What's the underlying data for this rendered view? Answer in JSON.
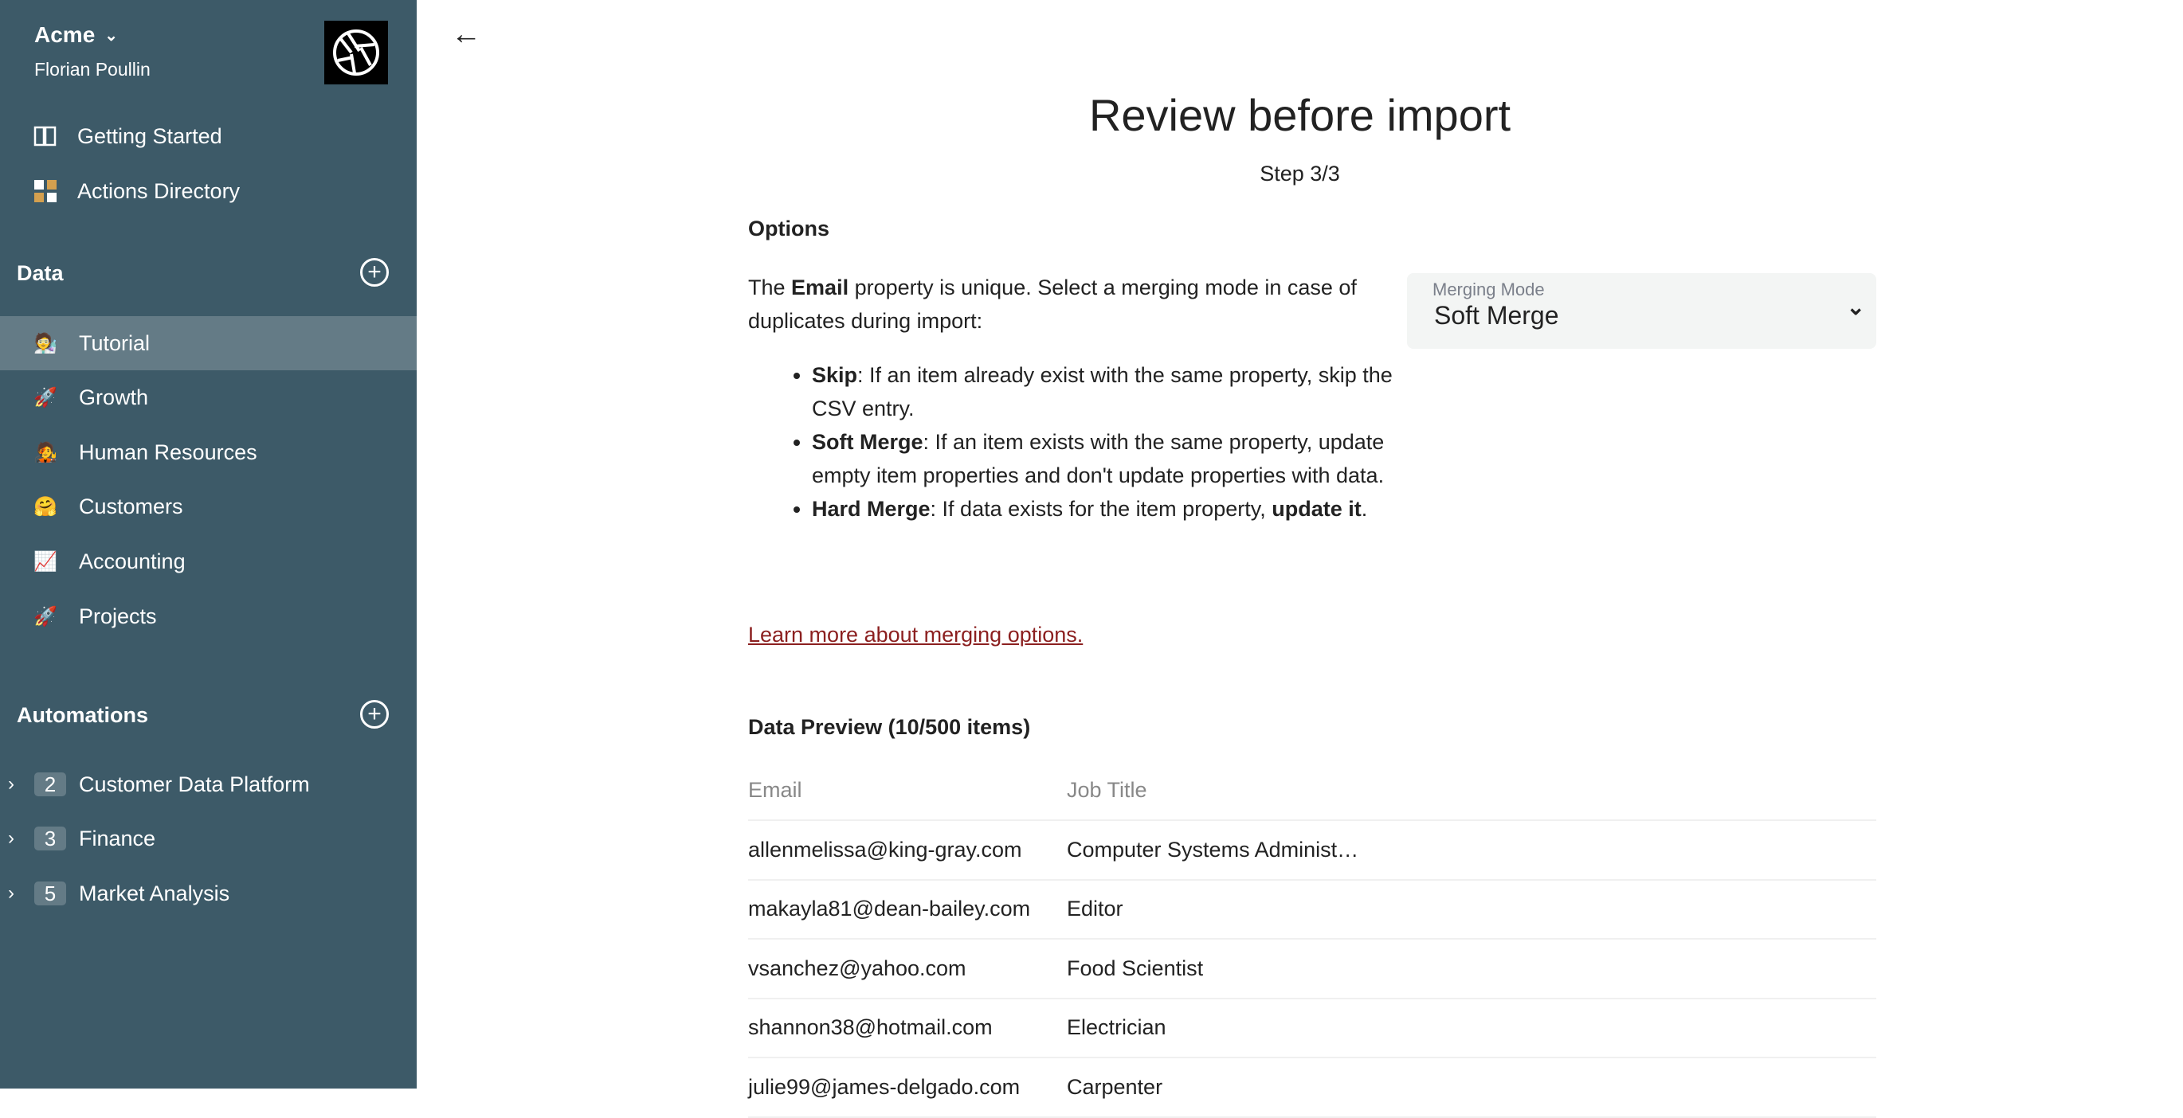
{
  "sidebar": {
    "workspace": "Acme",
    "user": "Florian Poullin",
    "top_items": [
      {
        "label": "Getting Started",
        "icon": "book-icon"
      },
      {
        "label": "Actions Directory",
        "icon": "grid-icon"
      }
    ],
    "data_section": {
      "title": "Data",
      "items": [
        {
          "label": "Tutorial",
          "emoji": "🧑‍🔬",
          "selected": true
        },
        {
          "label": "Growth",
          "emoji": "🚀"
        },
        {
          "label": "Human Resources",
          "emoji": "🧑‍🎤"
        },
        {
          "label": "Customers",
          "emoji": "🤗"
        },
        {
          "label": "Accounting",
          "emoji": "📈"
        },
        {
          "label": "Projects",
          "emoji": "🚀"
        }
      ]
    },
    "automations_section": {
      "title": "Automations",
      "items": [
        {
          "label": "Customer Data Platform",
          "count": "2"
        },
        {
          "label": "Finance",
          "count": "3"
        },
        {
          "label": "Market Analysis",
          "count": "5"
        }
      ]
    }
  },
  "main": {
    "title": "Review before import",
    "step": "Step 3/3",
    "options_title": "Options",
    "intro": {
      "pre": "The ",
      "bold": "Email",
      "post": " property is unique. Select a merging mode in case of duplicates during import:"
    },
    "bullets": [
      {
        "bold": "Skip",
        "text": ": If an item already exist with the same property, skip the CSV entry."
      },
      {
        "bold": "Soft Merge",
        "text": ": If an item exists with the same property, update empty item properties and don't update properties with data."
      },
      {
        "bold": "Hard Merge",
        "text": ": If data exists for the item property, ",
        "bold2": "update it",
        "tail": "."
      }
    ],
    "learn_more": "Learn more about merging options.",
    "merging_mode": {
      "label": "Merging Mode",
      "value": "Soft Merge"
    },
    "preview_title": "Data Preview (10/500 items)",
    "columns": [
      "Email",
      "Job Title"
    ],
    "rows": [
      [
        "allenmelissa@king-gray.com",
        "Computer Systems Administ…"
      ],
      [
        "makayla81@dean-bailey.com",
        "Editor"
      ],
      [
        "vsanchez@yahoo.com",
        "Food Scientist"
      ],
      [
        "shannon38@hotmail.com",
        "Electrician"
      ],
      [
        "julie99@james-delgado.com",
        "Carpenter"
      ]
    ]
  },
  "colors": {
    "sidebar": "#3d5a68",
    "selected": "#647b86",
    "link": "#8b1f1f"
  }
}
